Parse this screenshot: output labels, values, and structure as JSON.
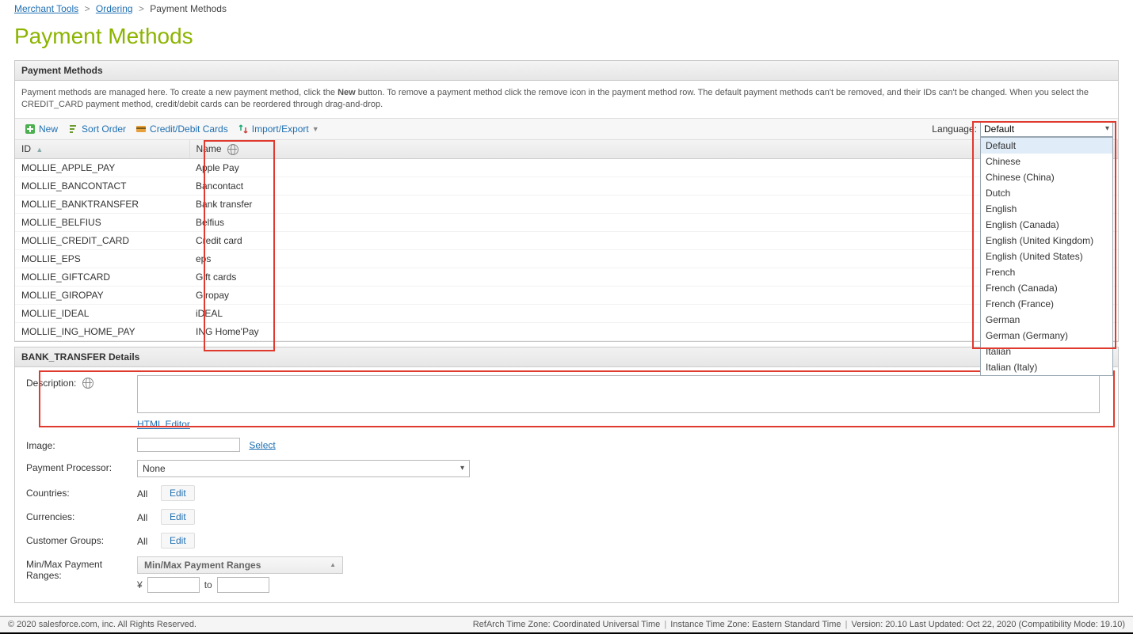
{
  "breadcrumb": {
    "merchant_tools": "Merchant Tools",
    "ordering": "Ordering",
    "current": "Payment Methods"
  },
  "page_title": "Payment Methods",
  "panel": {
    "header": "Payment Methods",
    "desc_prefix": "Payment methods are managed here. To create a new payment method, click the ",
    "desc_new": "New",
    "desc_suffix": " button. To remove a payment method click the remove icon in the payment method row. The default payment methods can't be removed, and their IDs can't be changed. When you select the CREDIT_CARD payment method, credit/debit cards can be reordered through drag-and-drop."
  },
  "toolbar": {
    "new_label": "New",
    "sort_label": "Sort Order",
    "cards_label": "Credit/Debit Cards",
    "imp_label": "Import/Export",
    "language_label": "Language:",
    "language_selected": "Default",
    "language_options": [
      "Default",
      "Chinese",
      "Chinese (China)",
      "Dutch",
      "English",
      "English (Canada)",
      "English (United Kingdom)",
      "English (United States)",
      "French",
      "French (Canada)",
      "French (France)",
      "German",
      "German (Germany)",
      "Italian",
      "Italian (Italy)"
    ]
  },
  "grid": {
    "columns": {
      "id": "ID",
      "name": "Name"
    },
    "rows": [
      {
        "id": "MOLLIE_APPLE_PAY",
        "name": "Apple Pay"
      },
      {
        "id": "MOLLIE_BANCONTACT",
        "name": "Bancontact"
      },
      {
        "id": "MOLLIE_BANKTRANSFER",
        "name": "Bank transfer"
      },
      {
        "id": "MOLLIE_BELFIUS",
        "name": "Belfius"
      },
      {
        "id": "MOLLIE_CREDIT_CARD",
        "name": "Credit card"
      },
      {
        "id": "MOLLIE_EPS",
        "name": "eps"
      },
      {
        "id": "MOLLIE_GIFTCARD",
        "name": "Gift cards"
      },
      {
        "id": "MOLLIE_GIROPAY",
        "name": "Giropay"
      },
      {
        "id": "MOLLIE_IDEAL",
        "name": "iDEAL"
      },
      {
        "id": "MOLLIE_ING_HOME_PAY",
        "name": "ING Home'Pay"
      }
    ]
  },
  "details": {
    "header": "BANK_TRANSFER Details",
    "description_label": "Description:",
    "description_value": "",
    "html_editor": "HTML Editor",
    "image_label": "Image:",
    "image_value": "",
    "image_select": "Select",
    "processor_label": "Payment Processor:",
    "processor_value": "None",
    "countries_label": "Countries:",
    "currencies_label": "Currencies:",
    "groups_label": "Customer Groups:",
    "all": "All",
    "edit": "Edit",
    "minmax_label": "Min/Max Payment Ranges:",
    "minmax_title": "Min/Max Payment Ranges",
    "currency_symbol": "¥",
    "to": "to"
  },
  "footer": {
    "left": "© 2020 salesforce.com, inc. All Rights Reserved.",
    "refarch": "RefArch Time Zone: Coordinated Universal Time",
    "instance": "Instance Time Zone: Eastern Standard Time",
    "version": "Version: 20.10 Last Updated: Oct 22, 2020 (Compatibility Mode: 19.10)"
  }
}
